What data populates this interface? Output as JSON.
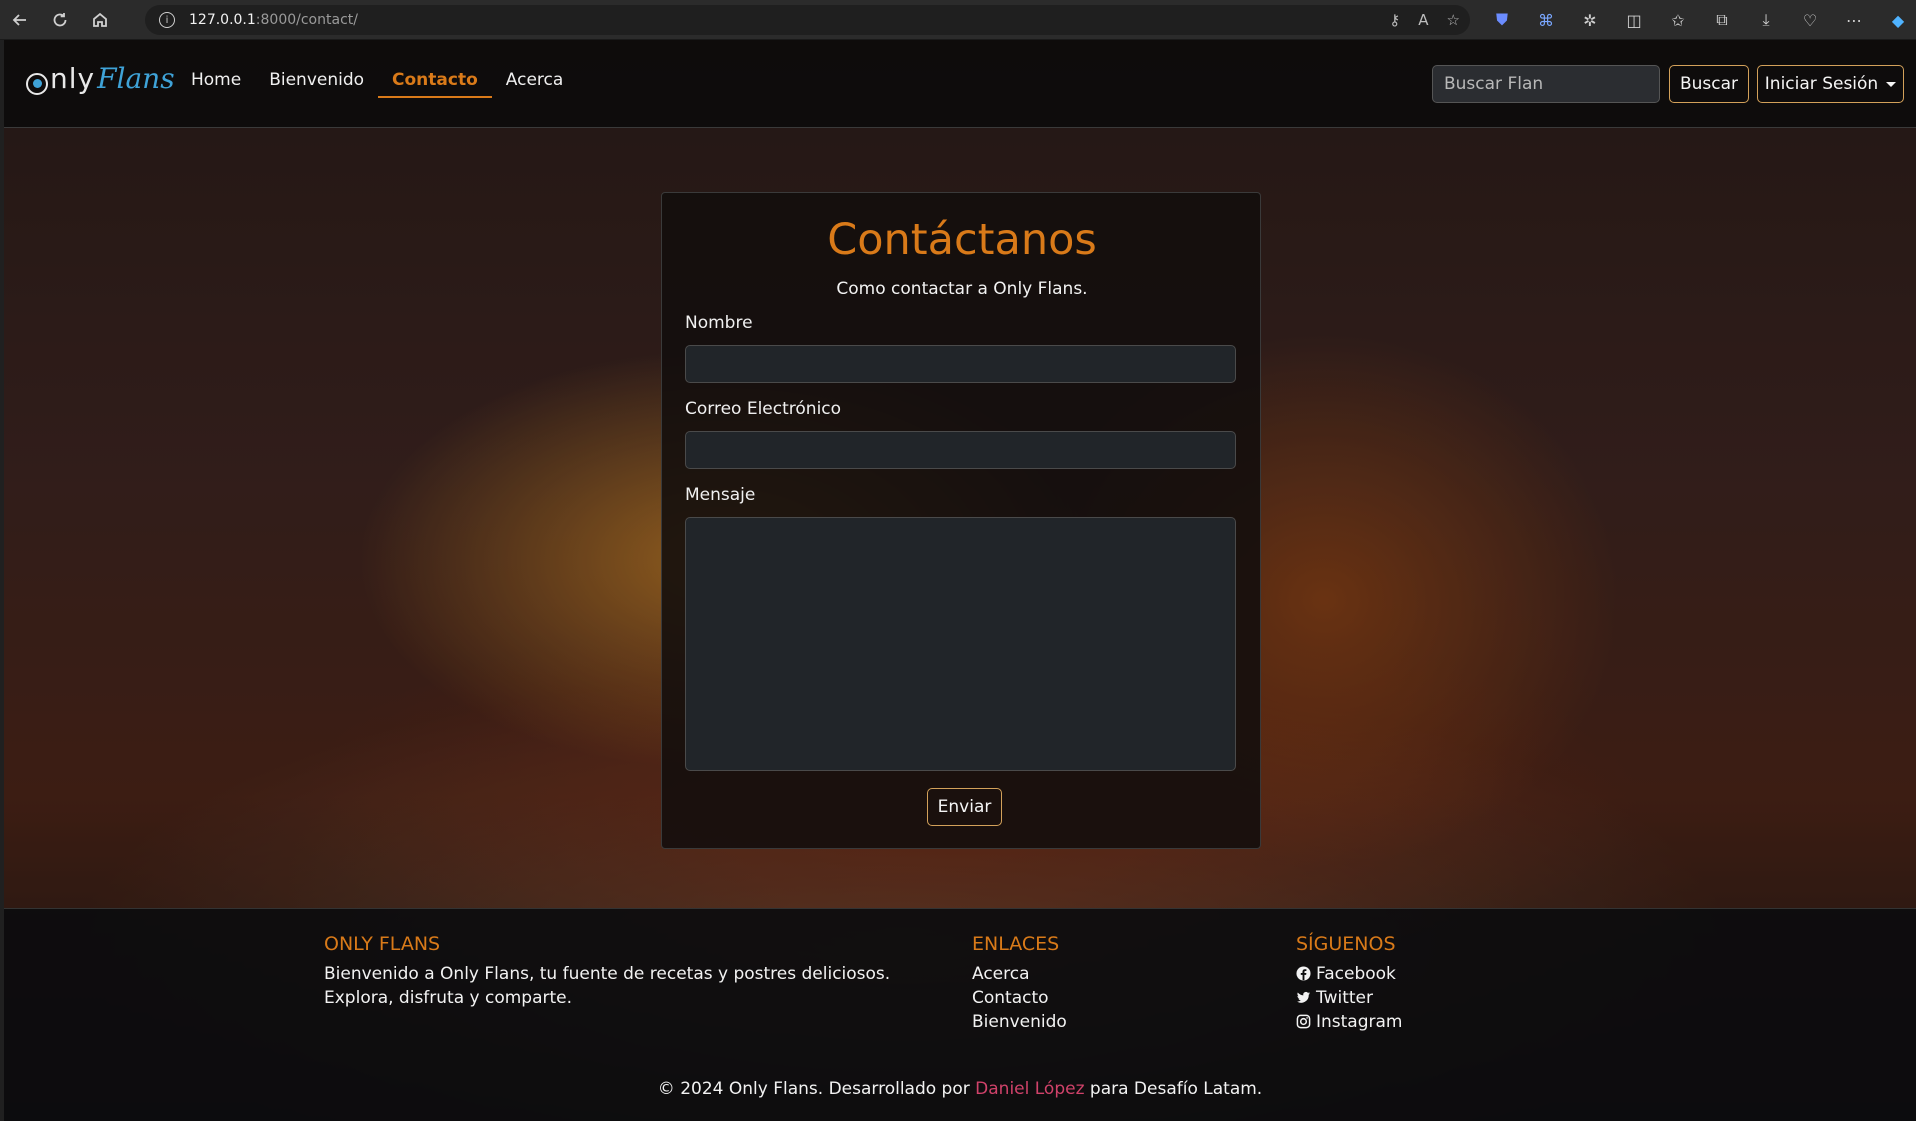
{
  "browser": {
    "url_host": "127.0.0.1",
    "url_path": ":8000/contact/"
  },
  "navbar": {
    "logo_only": "nly",
    "logo_flans": "Flans",
    "links": [
      {
        "label": "Home",
        "active": false
      },
      {
        "label": "Bienvenido",
        "active": false
      },
      {
        "label": "Contacto",
        "active": true
      },
      {
        "label": "Acerca",
        "active": false
      }
    ],
    "search_placeholder": "Buscar Flan",
    "search_button": "Buscar",
    "login_button": "Iniciar Sesión"
  },
  "contact": {
    "title": "Contáctanos",
    "subtitle": "Como contactar a Only Flans.",
    "name_label": "Nombre",
    "name_value": "",
    "email_label": "Correo Electrónico",
    "email_value": "",
    "message_label": "Mensaje",
    "message_value": "",
    "submit": "Enviar"
  },
  "footer": {
    "brand_title": "ONLY FLANS",
    "brand_text": "Bienvenido a Only Flans, tu fuente de recetas y postres deliciosos. Explora, disfruta y comparte.",
    "links_title": "ENLACES",
    "links": [
      "Acerca",
      "Contacto",
      "Bienvenido"
    ],
    "social_title": "SÍGUENOS",
    "social": [
      {
        "label": "Facebook",
        "icon": "facebook-icon"
      },
      {
        "label": "Twitter",
        "icon": "twitter-icon"
      },
      {
        "label": "Instagram",
        "icon": "instagram-icon"
      }
    ],
    "copyright_pre": "© 2024 Only Flans. Desarrollado por ",
    "copyright_author": "Daniel López",
    "copyright_post": " para Desafío Latam."
  },
  "colors": {
    "accent": "#d97a19",
    "logo_blue": "#3fa3d8",
    "author_link": "#d0426a",
    "button_border": "#d3a15a"
  }
}
